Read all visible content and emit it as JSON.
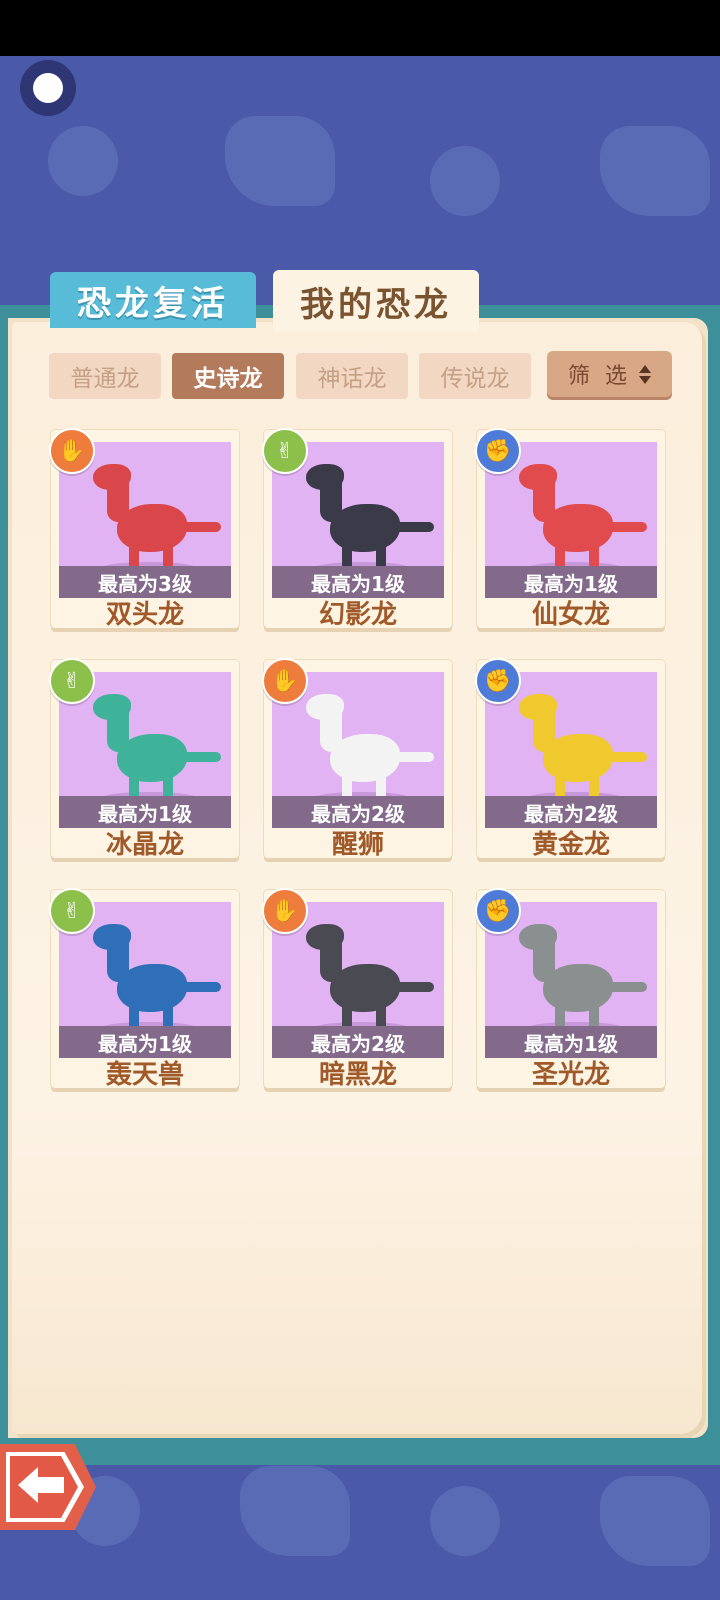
{
  "tabs": [
    {
      "label": "恐龙复活"
    },
    {
      "label": "我的恐龙"
    }
  ],
  "filters": [
    {
      "label": "普通龙",
      "active": false
    },
    {
      "label": "史诗龙",
      "active": true
    },
    {
      "label": "神话龙",
      "active": false
    },
    {
      "label": "传说龙",
      "active": false
    }
  ],
  "sort": {
    "label": "筛 选"
  },
  "cards": [
    {
      "name": "双头龙",
      "level": "最高为3级",
      "badge": "✋",
      "badge_color": "#ee7c3c",
      "color": "#d9474a"
    },
    {
      "name": "幻影龙",
      "level": "最高为1级",
      "badge": "✌",
      "badge_color": "#8cc04a",
      "color": "#3a3a48"
    },
    {
      "name": "仙女龙",
      "level": "最高为1级",
      "badge": "✊",
      "badge_color": "#4f7bd8",
      "color": "#e24b4e"
    },
    {
      "name": "冰晶龙",
      "level": "最高为1级",
      "badge": "✌",
      "badge_color": "#8cc04a",
      "color": "#3fb29a"
    },
    {
      "name": "醒狮",
      "level": "最高为2级",
      "badge": "✋",
      "badge_color": "#ee7c3c",
      "color": "#f3f3f3"
    },
    {
      "name": "黄金龙",
      "level": "最高为2级",
      "badge": "✊",
      "badge_color": "#4f7bd8",
      "color": "#f0c92e"
    },
    {
      "name": "轰天兽",
      "level": "最高为1级",
      "badge": "✌",
      "badge_color": "#8cc04a",
      "color": "#2e6fb8"
    },
    {
      "name": "暗黑龙",
      "level": "最高为2级",
      "badge": "✋",
      "badge_color": "#ee7c3c",
      "color": "#4a4a52"
    },
    {
      "name": "圣光龙",
      "level": "最高为1级",
      "badge": "✊",
      "badge_color": "#4f7bd8",
      "color": "#8a9090"
    }
  ]
}
